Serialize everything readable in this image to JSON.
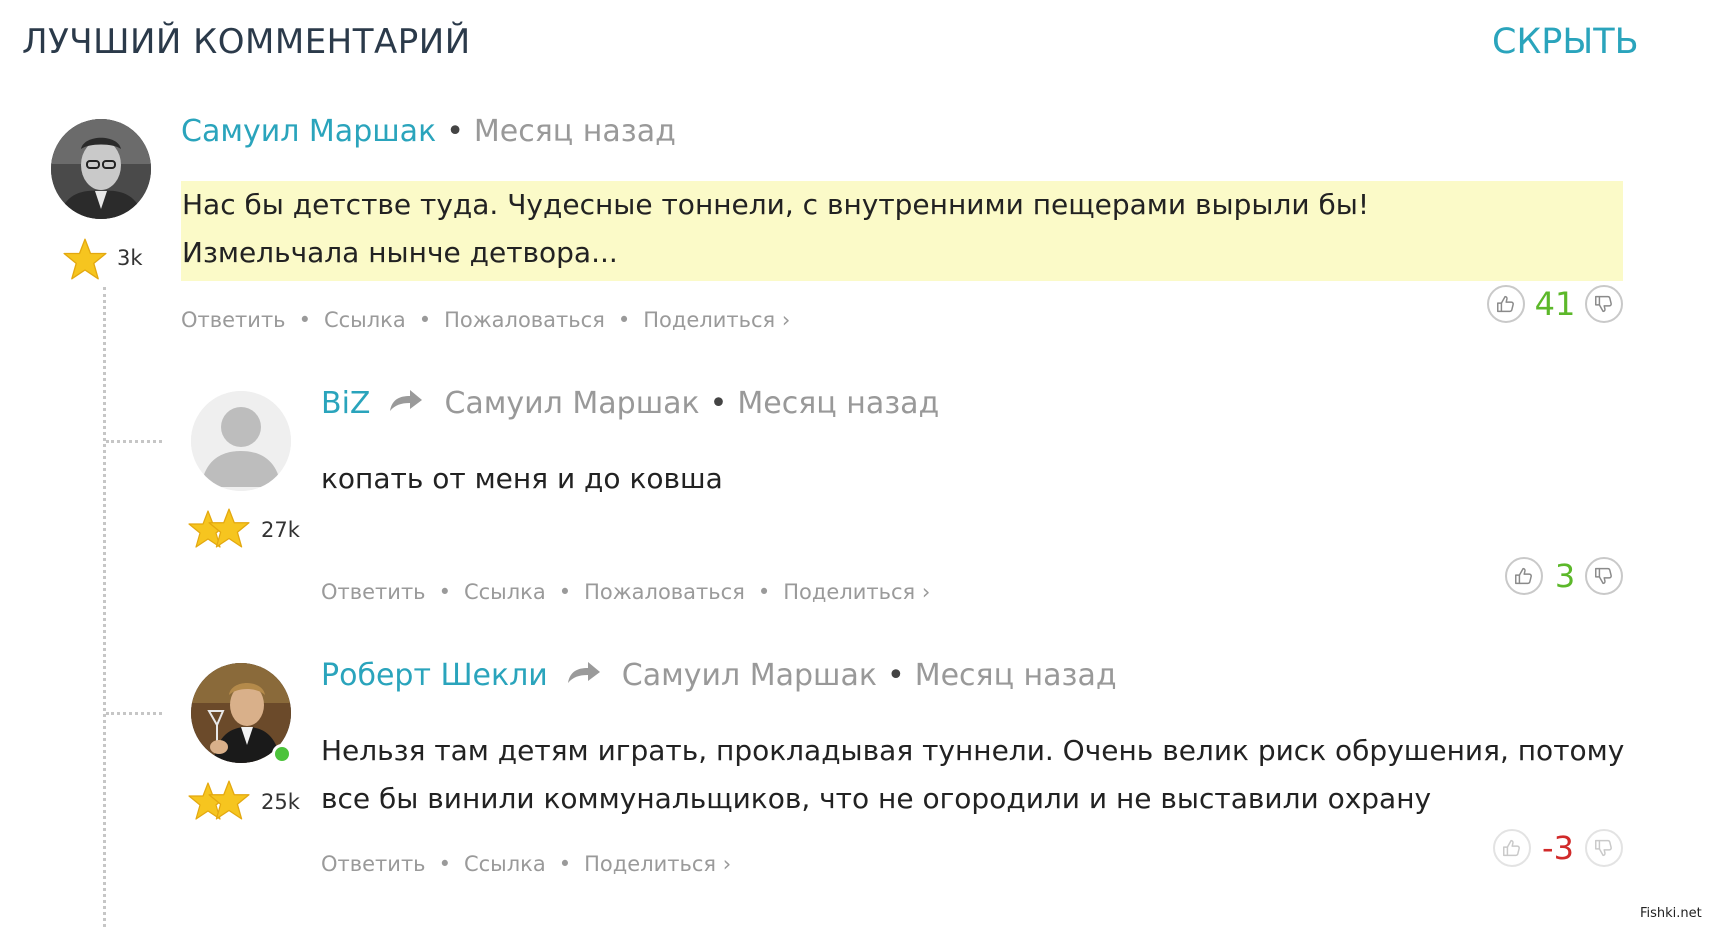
{
  "section": {
    "title": "ЛУЧШИЙ КОММЕНТАРИЙ",
    "hide_label": "СКРЫТЬ"
  },
  "colors": {
    "accent": "#2aa4bc",
    "positive": "#5cb82a",
    "negative": "#d12a2a",
    "highlight": "#fbfac8"
  },
  "comments": [
    {
      "author": "Самуил Маршак",
      "time": "Месяц назад",
      "rank_count": "3k",
      "text_lines": [
        "Нас бы детстве туда. Чудесные тоннели, с внутренними пещерами вырыли бы!",
        "Измельчала нынче детвора..."
      ],
      "actions": [
        "Ответить",
        "Ссылка",
        "Пожаловаться",
        "Поделиться ›"
      ],
      "score": "41"
    },
    {
      "author": "BiZ",
      "reply_to": "Самуил Маршак",
      "time": "Месяц назад",
      "rank_count": "27k",
      "text_lines": [
        "копать от меня и до ковша"
      ],
      "actions": [
        "Ответить",
        "Ссылка",
        "Пожаловаться",
        "Поделиться ›"
      ],
      "score": "3"
    },
    {
      "author": "Роберт Шекли",
      "reply_to": "Самуил Маршак",
      "time": "Месяц назад",
      "rank_count": "25k",
      "text_lines": [
        "Нельзя там детям играть, прокладывая туннели. Очень велик риск обрушения, потому",
        "все бы винили коммунальщиков, что не огородили и не выставили охрану"
      ],
      "actions": [
        "Ответить",
        "Ссылка",
        "Поделиться ›"
      ],
      "score": "-3"
    }
  ],
  "watermark": "Fishki.net"
}
